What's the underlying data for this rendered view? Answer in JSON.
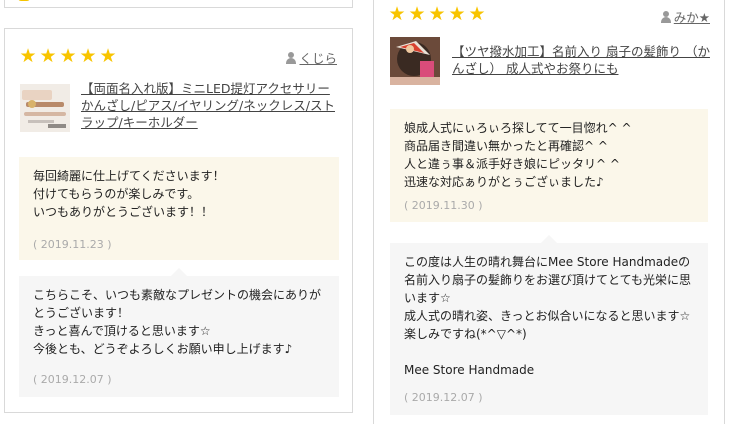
{
  "left": {
    "rating": [
      "★",
      "★",
      "★",
      "★",
      "★"
    ],
    "reviewer": "くじら",
    "product_title": "【両面名入れ版】ミニLED提灯アクセサリー かんざし/ピアス/イヤリング/ネックレス/ストラップ/キーホルダー",
    "review_text": "毎回綺麗に仕上げてくださいます！\n付けてもらうのが楽しみです。\nいつもありがとうございます！！",
    "review_date": "( 2019.11.23 )",
    "reply_text": "こちらこそ、いつも素敵なプレゼントの機会にありがとうございます！\nきっと喜んで頂けると思います☆\n今後とも、どうぞよろしくお願い申し上げます♪",
    "reply_date": "( 2019.12.07 )"
  },
  "right": {
    "rating": [
      "★",
      "★",
      "★",
      "★",
      "★"
    ],
    "reviewer": "みか★",
    "product_title": "【ツヤ撥水加工】名前入り 扇子の髪飾り （かんざし） 成人式やお祭りにも",
    "review_text": "娘成人式にぃろぃろ探してて一目惚れ^ ^\n商品届き間違い無かったと再確認^ ^\n人と違ぅ事＆派手好き娘にピッタリ^ ^\n迅速な対応ぁりがとぅござぃました♪",
    "review_date": "( 2019.11.30 )",
    "reply_text": "この度は人生の晴れ舞台にMee Store Handmadeの名前入り扇子の髪飾りをお選び頂けてとても光栄に思います☆\n成人式の晴れ姿、きっとお似合いになると思います☆楽しみですね(*^▽^*)\n\nMee Store Handmade",
    "reply_date": "( 2019.12.07 )"
  },
  "colors": {
    "star": "#f8c400",
    "review_bg": "#fbf7ea",
    "reply_bg": "#f6f6f6"
  },
  "icons": {
    "reviewer": "person-icon",
    "rating": "star-icon"
  }
}
